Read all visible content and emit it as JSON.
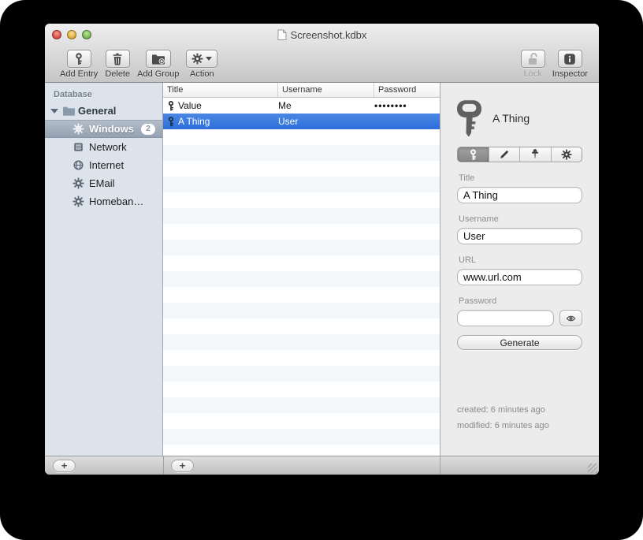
{
  "window": {
    "title": "Screenshot.kdbx"
  },
  "toolbar": {
    "add_entry": "Add Entry",
    "delete": "Delete",
    "add_group": "Add Group",
    "action": "Action",
    "lock": "Lock",
    "inspector": "Inspector"
  },
  "sidebar": {
    "header": "Database",
    "group": "General",
    "items": [
      {
        "label": "Windows",
        "badge": "2"
      },
      {
        "label": "Network"
      },
      {
        "label": "Internet"
      },
      {
        "label": "EMail"
      },
      {
        "label": "Homeban…"
      }
    ]
  },
  "table": {
    "columns": [
      "Title",
      "Username",
      "Password"
    ],
    "rows": [
      {
        "title": "Value",
        "username": "Me",
        "password": "••••••••"
      },
      {
        "title": "A Thing",
        "username": "User",
        "password": ""
      }
    ]
  },
  "inspector": {
    "entry_title": "A Thing",
    "tabs": [
      "key",
      "pencil",
      "pin",
      "gear"
    ],
    "labels": {
      "title": "Title",
      "username": "Username",
      "url": "URL",
      "password": "Password"
    },
    "values": {
      "title": "A Thing",
      "username": "User",
      "url": "www.url.com",
      "password": ""
    },
    "generate_label": "Generate",
    "created": "created: 6 minutes ago",
    "modified": "modified: 6 minutes ago"
  },
  "footer": {
    "add_label": "+"
  },
  "colors": {
    "selection_blue": "#2e6edb",
    "sidebar_bg": "#dde3ea",
    "sidebar_selection": "#94a1b2",
    "chrome_top": "#efefef",
    "chrome_bottom": "#c6c6c6"
  }
}
